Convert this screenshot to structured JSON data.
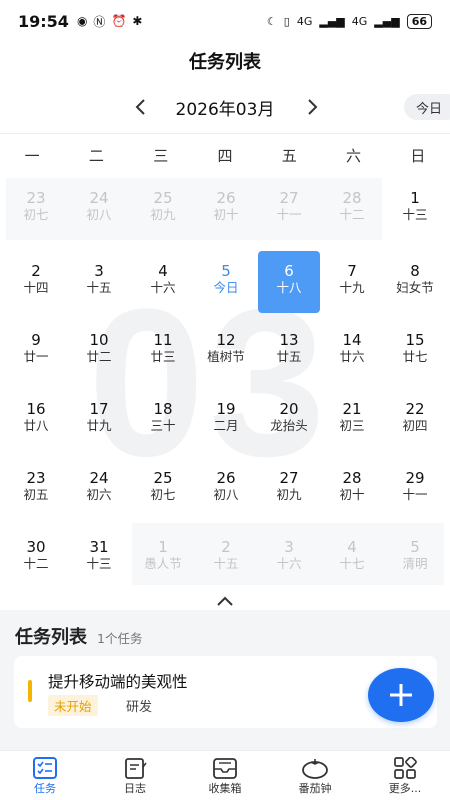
{
  "status_bar": {
    "time": "19:54",
    "network_4g_1": "4G",
    "network_4g_2": "4G",
    "battery": "66"
  },
  "header": {
    "title": "任务列表",
    "month_label": "2026年03月",
    "today_button": "今日"
  },
  "weekdays": [
    "一",
    "二",
    "三",
    "四",
    "五",
    "六",
    "日"
  ],
  "watermark": "03",
  "calendar": {
    "weeks": [
      [
        {
          "day": "23",
          "lunar": "初七",
          "state": "other"
        },
        {
          "day": "24",
          "lunar": "初八",
          "state": "other"
        },
        {
          "day": "25",
          "lunar": "初九",
          "state": "other"
        },
        {
          "day": "26",
          "lunar": "初十",
          "state": "other"
        },
        {
          "day": "27",
          "lunar": "十一",
          "state": "other"
        },
        {
          "day": "28",
          "lunar": "十二",
          "state": "other"
        },
        {
          "day": "1",
          "lunar": "十三",
          "state": "normal"
        }
      ],
      [
        {
          "day": "2",
          "lunar": "十四",
          "state": "normal"
        },
        {
          "day": "3",
          "lunar": "十五",
          "state": "normal"
        },
        {
          "day": "4",
          "lunar": "十六",
          "state": "normal"
        },
        {
          "day": "5",
          "lunar": "今日",
          "state": "today"
        },
        {
          "day": "6",
          "lunar": "十八",
          "state": "selected"
        },
        {
          "day": "7",
          "lunar": "十九",
          "state": "normal"
        },
        {
          "day": "8",
          "lunar": "妇女节",
          "state": "normal"
        }
      ],
      [
        {
          "day": "9",
          "lunar": "廿一",
          "state": "normal"
        },
        {
          "day": "10",
          "lunar": "廿二",
          "state": "normal"
        },
        {
          "day": "11",
          "lunar": "廿三",
          "state": "normal"
        },
        {
          "day": "12",
          "lunar": "植树节",
          "state": "normal"
        },
        {
          "day": "13",
          "lunar": "廿五",
          "state": "normal"
        },
        {
          "day": "14",
          "lunar": "廿六",
          "state": "normal"
        },
        {
          "day": "15",
          "lunar": "廿七",
          "state": "normal"
        }
      ],
      [
        {
          "day": "16",
          "lunar": "廿八",
          "state": "normal"
        },
        {
          "day": "17",
          "lunar": "廿九",
          "state": "normal"
        },
        {
          "day": "18",
          "lunar": "三十",
          "state": "normal"
        },
        {
          "day": "19",
          "lunar": "二月",
          "state": "normal"
        },
        {
          "day": "20",
          "lunar": "龙抬头",
          "state": "normal"
        },
        {
          "day": "21",
          "lunar": "初三",
          "state": "normal"
        },
        {
          "day": "22",
          "lunar": "初四",
          "state": "normal"
        }
      ],
      [
        {
          "day": "23",
          "lunar": "初五",
          "state": "normal"
        },
        {
          "day": "24",
          "lunar": "初六",
          "state": "normal"
        },
        {
          "day": "25",
          "lunar": "初七",
          "state": "normal"
        },
        {
          "day": "26",
          "lunar": "初八",
          "state": "normal"
        },
        {
          "day": "27",
          "lunar": "初九",
          "state": "normal"
        },
        {
          "day": "28",
          "lunar": "初十",
          "state": "normal"
        },
        {
          "day": "29",
          "lunar": "十一",
          "state": "normal"
        }
      ],
      [
        {
          "day": "30",
          "lunar": "十二",
          "state": "normal"
        },
        {
          "day": "31",
          "lunar": "十三",
          "state": "normal"
        },
        {
          "day": "1",
          "lunar": "愚人节",
          "state": "other"
        },
        {
          "day": "2",
          "lunar": "十五",
          "state": "other"
        },
        {
          "day": "3",
          "lunar": "十六",
          "state": "other"
        },
        {
          "day": "4",
          "lunar": "十七",
          "state": "other"
        },
        {
          "day": "5",
          "lunar": "清明",
          "state": "other"
        }
      ]
    ]
  },
  "tasks": {
    "title": "任务列表",
    "count": "1个任务",
    "items": [
      {
        "name": "提升移动端的美观性",
        "status": "未开始",
        "tag": "研发"
      }
    ]
  },
  "bottom_nav": [
    {
      "label": "任务",
      "icon": "task-list-icon",
      "active": true
    },
    {
      "label": "日志",
      "icon": "journal-icon",
      "active": false
    },
    {
      "label": "收集箱",
      "icon": "inbox-icon",
      "active": false
    },
    {
      "label": "番茄钟",
      "icon": "tomato-timer-icon",
      "active": false
    },
    {
      "label": "更多...",
      "icon": "more-grid-icon",
      "active": false
    }
  ],
  "colors": {
    "accent": "#1f6ff0",
    "selected_day": "#4d9bf5",
    "today_text": "#3b8be8",
    "status_pending": "#e5a000"
  }
}
